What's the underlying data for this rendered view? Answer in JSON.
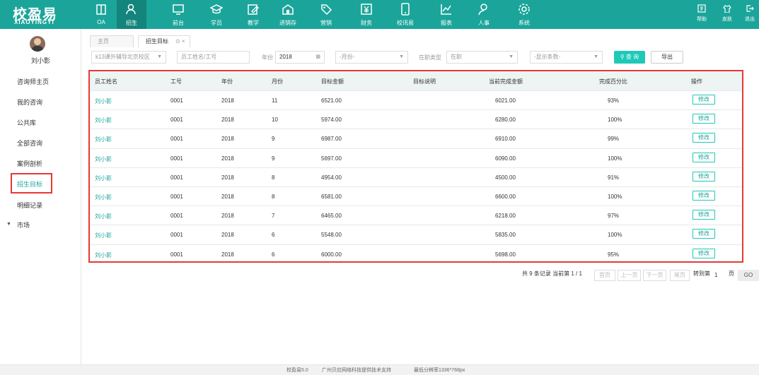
{
  "app": {
    "logo_cn": "校盈易",
    "logo_en": "XIAOYINGYI"
  },
  "topnav": [
    {
      "label": "OA",
      "icon": "book-icon"
    },
    {
      "label": "招生",
      "icon": "users-icon",
      "active": true
    },
    {
      "label": "前台",
      "icon": "monitor-icon"
    },
    {
      "label": "学员",
      "icon": "graduation-icon"
    },
    {
      "label": "教学",
      "icon": "edit-icon"
    },
    {
      "label": "进销存",
      "icon": "box-icon"
    },
    {
      "label": "营销",
      "icon": "tag-icon"
    },
    {
      "label": "财务",
      "icon": "yen-icon"
    },
    {
      "label": "校讯易",
      "icon": "phone-icon"
    },
    {
      "label": "报表",
      "icon": "chart-icon"
    },
    {
      "label": "人事",
      "icon": "person-icon"
    },
    {
      "label": "系统",
      "icon": "gear-icon"
    }
  ],
  "rightnav": [
    {
      "label": "帮助",
      "icon": "help-icon"
    },
    {
      "label": "皮肤",
      "icon": "shirt-icon"
    },
    {
      "label": "退出",
      "icon": "logout-icon"
    }
  ],
  "user": {
    "name": "刘小影"
  },
  "sidebar": {
    "items": [
      {
        "label": "咨询师主页"
      },
      {
        "label": "我的咨询"
      },
      {
        "label": "公共库"
      },
      {
        "label": "全部咨询"
      },
      {
        "label": "案例剖析"
      },
      {
        "label": "招生目标",
        "active": true
      },
      {
        "label": "明细记录"
      },
      {
        "label": "市场"
      }
    ]
  },
  "tabs": [
    {
      "label": "主页"
    },
    {
      "label": "招生目标",
      "active": true,
      "close": "⊙ ×"
    }
  ],
  "filters": {
    "campus": "k13课外辅导北京校区",
    "employee_placeholder": "员工姓名/工号",
    "year_label": "年份",
    "year_value": "2018",
    "month": "-月份-",
    "status_label": "在职类型",
    "status_value": "在职",
    "count": "-显示条数-",
    "search_label": "查 询",
    "export_label": "导出"
  },
  "table": {
    "headers": [
      "员工姓名",
      "工号",
      "年份",
      "月份",
      "目标金额",
      "目标说明",
      "当前完成金额",
      "完成百分比",
      "操作"
    ],
    "edit_label": "修改",
    "rows": [
      {
        "name": "刘小影",
        "id": "0001",
        "year": "2018",
        "month": "11",
        "target": "6521.00",
        "note": "",
        "current": "6021.00",
        "pct": "93%"
      },
      {
        "name": "刘小影",
        "id": "0001",
        "year": "2018",
        "month": "10",
        "target": "5974.00",
        "note": "",
        "current": "6280.00",
        "pct": "100%"
      },
      {
        "name": "刘小影",
        "id": "0001",
        "year": "2018",
        "month": "9",
        "target": "6987.00",
        "note": "",
        "current": "6910.00",
        "pct": "99%"
      },
      {
        "name": "刘小影",
        "id": "0001",
        "year": "2018",
        "month": "9",
        "target": "5697.00",
        "note": "",
        "current": "6090.00",
        "pct": "100%"
      },
      {
        "name": "刘小影",
        "id": "0001",
        "year": "2018",
        "month": "8",
        "target": "4954.00",
        "note": "",
        "current": "4500.00",
        "pct": "91%"
      },
      {
        "name": "刘小影",
        "id": "0001",
        "year": "2018",
        "month": "8",
        "target": "6581.00",
        "note": "",
        "current": "6600.00",
        "pct": "100%"
      },
      {
        "name": "刘小影",
        "id": "0001",
        "year": "2018",
        "month": "7",
        "target": "6465.00",
        "note": "",
        "current": "6218.00",
        "pct": "97%"
      },
      {
        "name": "刘小影",
        "id": "0001",
        "year": "2018",
        "month": "6",
        "target": "5548.00",
        "note": "",
        "current": "5835.00",
        "pct": "100%"
      },
      {
        "name": "刘小影",
        "id": "0001",
        "year": "2018",
        "month": "6",
        "target": "6000.00",
        "note": "",
        "current": "5698.00",
        "pct": "95%"
      }
    ]
  },
  "pager": {
    "summary": "共 9 条记录 当前第 1 / 1",
    "first": "首页",
    "prev": "上一页",
    "next": "下一页",
    "last": "尾页",
    "goto": "转到第",
    "page_value": "1",
    "page_unit": "页",
    "go": "GO"
  },
  "footer": {
    "version": "校盈易5.0",
    "support": "广州贝应网络科技提供技术支持",
    "resolution": "最低分辨率1336*768px"
  },
  "colors": {
    "brand": "#1ba59a",
    "highlight": "#e53935",
    "accent": "#1ec9b8"
  }
}
